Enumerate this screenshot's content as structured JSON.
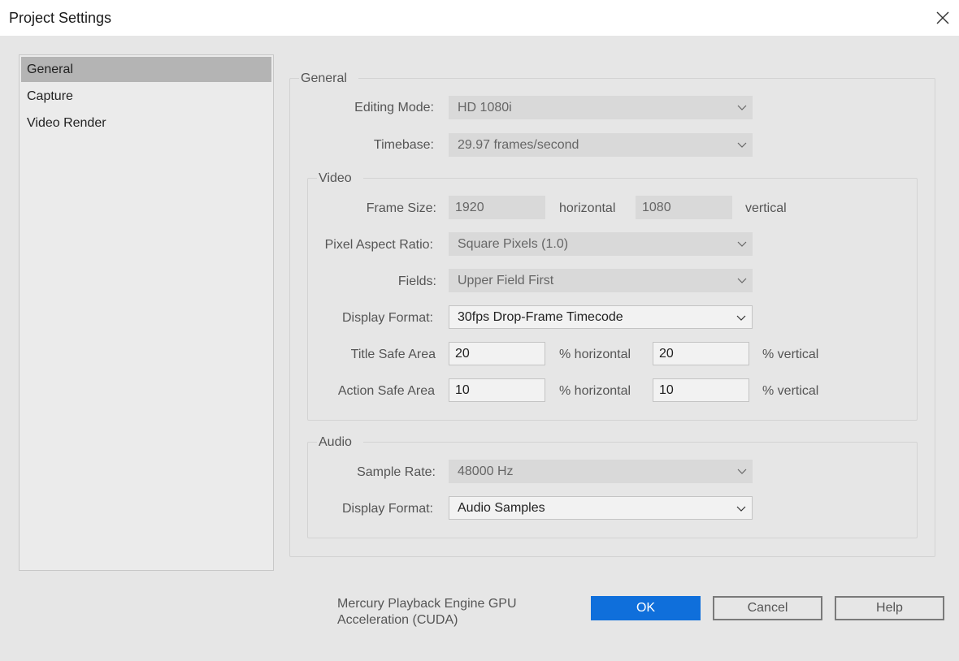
{
  "window": {
    "title": "Project Settings"
  },
  "sidebar": {
    "items": [
      {
        "label": "General",
        "selected": true
      },
      {
        "label": "Capture",
        "selected": false
      },
      {
        "label": "Video Render",
        "selected": false
      }
    ]
  },
  "general": {
    "group_title": "General",
    "editing_mode": {
      "label": "Editing Mode:",
      "value": "HD 1080i"
    },
    "timebase": {
      "label": "Timebase:",
      "value": "29.97 frames/second"
    }
  },
  "video": {
    "group_title": "Video",
    "frame_size": {
      "label": "Frame Size:",
      "width": "1920",
      "width_unit": "horizontal",
      "height": "1080",
      "height_unit": "vertical"
    },
    "pixel_aspect_ratio": {
      "label": "Pixel Aspect Ratio:",
      "value": "Square Pixels (1.0)"
    },
    "fields": {
      "label": "Fields:",
      "value": "Upper Field First"
    },
    "display_format": {
      "label": "Display Format:",
      "value": "30fps Drop-Frame Timecode"
    },
    "title_safe": {
      "label": "Title Safe Area",
      "h": "20",
      "h_unit": "% horizontal",
      "v": "20",
      "v_unit": "% vertical"
    },
    "action_safe": {
      "label": "Action Safe Area",
      "h": "10",
      "h_unit": "% horizontal",
      "v": "10",
      "v_unit": "% vertical"
    }
  },
  "audio": {
    "group_title": "Audio",
    "sample_rate": {
      "label": "Sample Rate:",
      "value": "48000 Hz"
    },
    "display_format": {
      "label": "Display Format:",
      "value": "Audio Samples"
    }
  },
  "footer": {
    "gpu_note_line1": "Mercury Playback Engine GPU",
    "gpu_note_line2": "Acceleration (CUDA)",
    "ok": "OK",
    "cancel": "Cancel",
    "help": "Help"
  },
  "colors": {
    "accent": "#0f6fdb",
    "selected_item": "#b4b4b4",
    "background": "#e6e6e6"
  },
  "icons": {
    "close": "close-icon",
    "dropdown": "chevron-down-icon"
  }
}
